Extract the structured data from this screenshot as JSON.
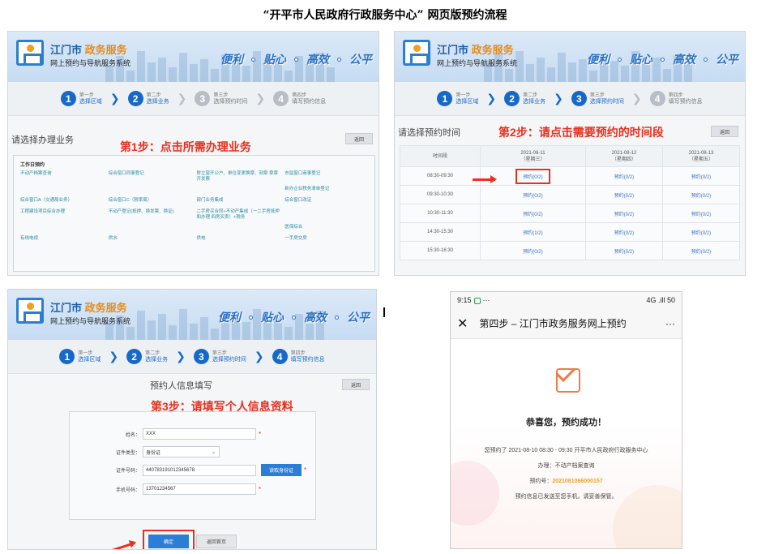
{
  "doc_title": "“开平市人民政府行政服务中心” 网页版预约流程",
  "header": {
    "brand_city": "江门市",
    "brand_name": "政务服务",
    "subtitle": "网上预约与导航服务系统",
    "slogans": [
      "便利",
      "贴心",
      "高效",
      "公平"
    ]
  },
  "steps": [
    {
      "num": "1",
      "small": "第一步",
      "label": "选择区域"
    },
    {
      "num": "2",
      "small": "第二步",
      "label": "选择业务"
    },
    {
      "num": "3",
      "small": "第三步",
      "label": "选择预约时间"
    },
    {
      "num": "4",
      "small": "第四步",
      "label": "填写预约信息"
    }
  ],
  "panel1": {
    "section_title": "请选择办理业务",
    "back_label": "返回",
    "annotation": "第1步：点击所需办理业务",
    "list_header": "工作日预约",
    "items": [
      "不动产档案查询",
      "综合窗口同事登记",
      "财立窗开公户、单位变更换章、刻章 章章开发票",
      "市监窗口商事登记",
      "",
      "",
      "",
      "新办企业税务清单登记",
      "综合窗口A（交通局业务）",
      "综合窗口C（税率局）",
      "部门业务集成",
      "综合窗口改证",
      "工程建设项目综合办理",
      "不动产登记(抵押、换发票、换证)",
      "二手房买合同+不动产集成（一二手房抵押和办理 四房买卖）+税务",
      "",
      "",
      "",
      "",
      "医保综合",
      "有线电视",
      "供水",
      "供电",
      "一手房交房"
    ]
  },
  "panel2": {
    "section_title": "请选择预约时间",
    "back_label": "返回",
    "annotation": "第2步：请点击需要预约的时间段",
    "col_time": "时间段",
    "dates": [
      {
        "date": "2021-08-11",
        "day": "（星期三）"
      },
      {
        "date": "2021-08-12",
        "day": "（星期四）"
      },
      {
        "date": "2021-08-13",
        "day": "（星期五）"
      }
    ],
    "rows": [
      {
        "time": "08:30-09:30",
        "slots": [
          "预约(0/2)",
          "预约(0/2)",
          "预约(0/2)"
        ]
      },
      {
        "time": "09:30-10:30",
        "slots": [
          "预约(0/2)",
          "预约(0/2)",
          "预约(0/2)"
        ]
      },
      {
        "time": "10:30-11:30",
        "slots": [
          "预约(0/2)",
          "预约(0/2)",
          "预约(0/2)"
        ]
      },
      {
        "time": "14:30-15:30",
        "slots": [
          "预约(1/2)",
          "预约(0/2)",
          "预约(0/2)"
        ]
      },
      {
        "time": "15:30-16:30",
        "slots": [
          "预约(0/2)",
          "预约(0/2)",
          "预约(0/2)"
        ]
      }
    ]
  },
  "panel3": {
    "section_title": "预约人信息填写",
    "back_label": "返回",
    "annotation": "第3步：请填写个人信息资料",
    "fields": [
      {
        "label": "姓名：",
        "value": "XXX"
      },
      {
        "label": "证件类型：",
        "value": "身份证"
      },
      {
        "label": "证件号码：",
        "value": "440783191012345678"
      },
      {
        "label": "手机号码：",
        "value": "13701234567"
      }
    ],
    "read_id_btn": "读取身份证",
    "confirm_btn": "确定",
    "back_home_btn": "返回首页"
  },
  "panel4": {
    "time": "9:15",
    "status_right": "4G .ill 50",
    "nav_title": "第四步 – 江门市政务服务网上预约",
    "nav_more": "···",
    "success_title": "恭喜您，预约成功！",
    "line1": "您预约了 2021-08-10 08:30 - 09:30 开平市人民政府行政服务中心",
    "line2": "办理：不动产档案查询",
    "line3_label": "预约号：",
    "line3_value": "2021081066000157",
    "line4": "预约信息已发送至您手机，请妥善保管。",
    "close_label": "关闭"
  }
}
